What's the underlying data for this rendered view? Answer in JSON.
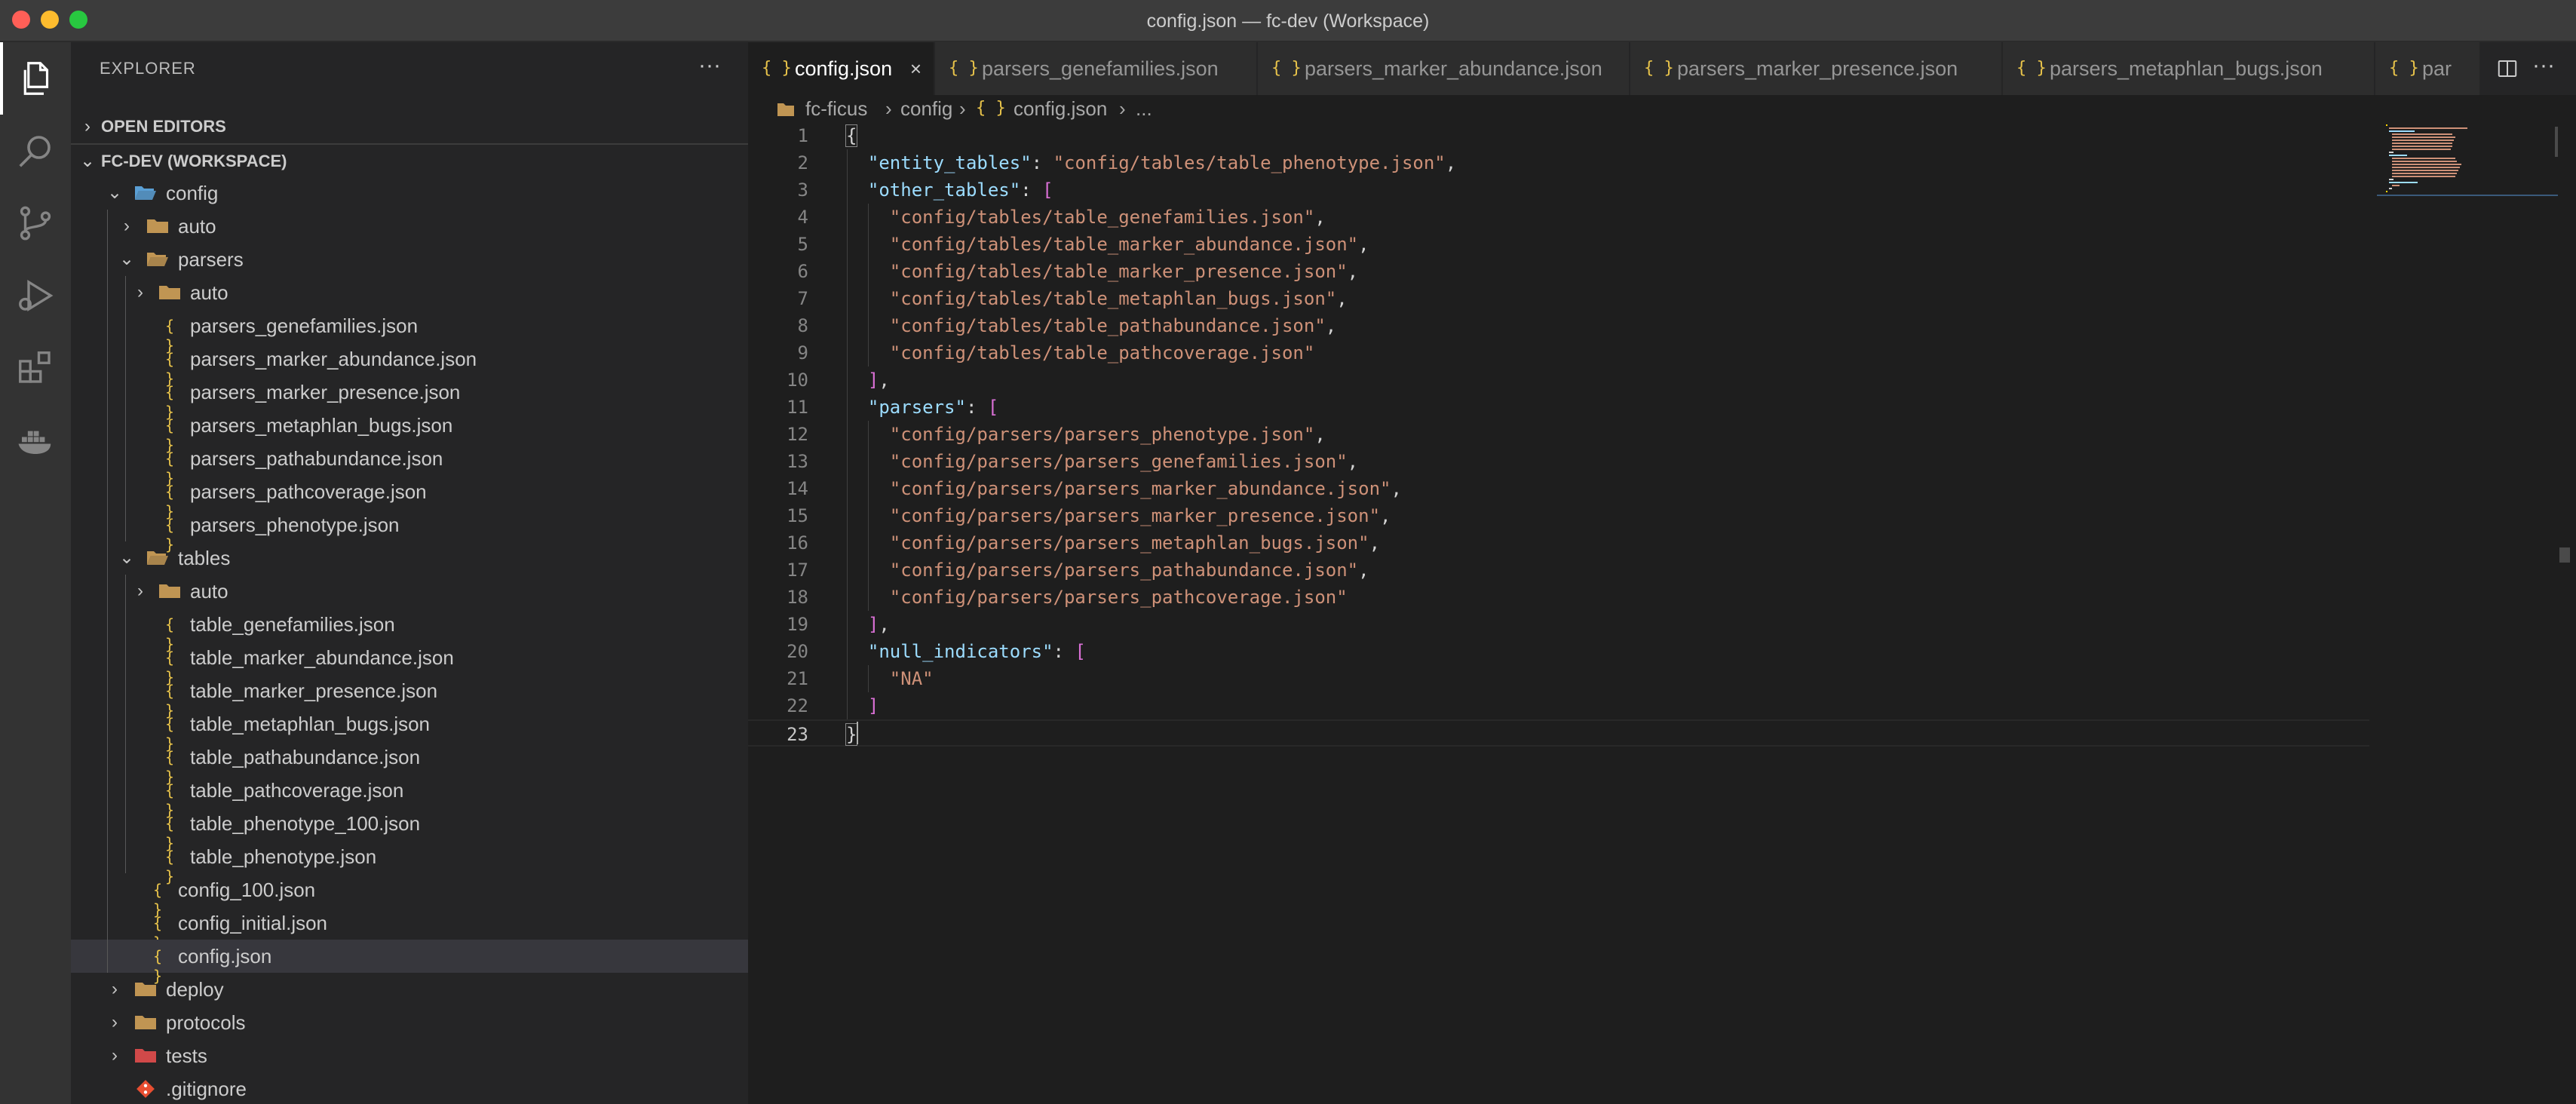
{
  "window": {
    "title": "config.json — fc-dev (Workspace)"
  },
  "activity_bar": [
    {
      "name": "explorer-icon",
      "active": true
    },
    {
      "name": "search-icon",
      "active": false
    },
    {
      "name": "source-control-icon",
      "active": false
    },
    {
      "name": "run-debug-icon",
      "active": false
    },
    {
      "name": "extensions-icon",
      "active": false
    },
    {
      "name": "docker-icon",
      "active": false
    }
  ],
  "sidebar": {
    "title": "EXPLORER",
    "more": "···",
    "open_editors": "OPEN EDITORS",
    "workspace": "FC-DEV (WORKSPACE)",
    "tree": [
      {
        "label": "config",
        "kind": "folder-open-special",
        "depth": 0,
        "expanded": true
      },
      {
        "label": "auto",
        "kind": "folder",
        "depth": 1,
        "expanded": false
      },
      {
        "label": "parsers",
        "kind": "folder-open",
        "depth": 1,
        "expanded": true
      },
      {
        "label": "auto",
        "kind": "folder",
        "depth": 2,
        "expanded": false
      },
      {
        "label": "parsers_genefamilies.json",
        "kind": "json",
        "depth": 2
      },
      {
        "label": "parsers_marker_abundance.json",
        "kind": "json",
        "depth": 2
      },
      {
        "label": "parsers_marker_presence.json",
        "kind": "json",
        "depth": 2
      },
      {
        "label": "parsers_metaphlan_bugs.json",
        "kind": "json",
        "depth": 2
      },
      {
        "label": "parsers_pathabundance.json",
        "kind": "json",
        "depth": 2
      },
      {
        "label": "parsers_pathcoverage.json",
        "kind": "json",
        "depth": 2
      },
      {
        "label": "parsers_phenotype.json",
        "kind": "json",
        "depth": 2
      },
      {
        "label": "tables",
        "kind": "folder-open",
        "depth": 1,
        "expanded": true
      },
      {
        "label": "auto",
        "kind": "folder",
        "depth": 2,
        "expanded": false
      },
      {
        "label": "table_genefamilies.json",
        "kind": "json",
        "depth": 2
      },
      {
        "label": "table_marker_abundance.json",
        "kind": "json",
        "depth": 2
      },
      {
        "label": "table_marker_presence.json",
        "kind": "json",
        "depth": 2
      },
      {
        "label": "table_metaphlan_bugs.json",
        "kind": "json",
        "depth": 2
      },
      {
        "label": "table_pathabundance.json",
        "kind": "json",
        "depth": 2
      },
      {
        "label": "table_pathcoverage.json",
        "kind": "json",
        "depth": 2
      },
      {
        "label": "table_phenotype_100.json",
        "kind": "json",
        "depth": 2
      },
      {
        "label": "table_phenotype.json",
        "kind": "json",
        "depth": 2
      },
      {
        "label": "config_100.json",
        "kind": "json",
        "depth": 1
      },
      {
        "label": "config_initial.json",
        "kind": "json",
        "depth": 1
      },
      {
        "label": "config.json",
        "kind": "json",
        "depth": 1,
        "selected": true
      },
      {
        "label": "deploy",
        "kind": "folder",
        "depth": 0,
        "expanded": false
      },
      {
        "label": "protocols",
        "kind": "folder",
        "depth": 0,
        "expanded": false
      },
      {
        "label": "tests",
        "kind": "folder-special",
        "depth": 0,
        "expanded": false
      },
      {
        "label": ".gitignore",
        "kind": "git",
        "depth": 0
      }
    ]
  },
  "tabs": [
    {
      "label": "config.json",
      "active": true,
      "close": "×"
    },
    {
      "label": "parsers_genefamilies.json",
      "active": false
    },
    {
      "label": "parsers_marker_abundance.json",
      "active": false
    },
    {
      "label": "parsers_marker_presence.json",
      "active": false
    },
    {
      "label": "parsers_metaphlan_bugs.json",
      "active": false
    },
    {
      "label": "par",
      "active": false
    }
  ],
  "tab_json_icon": "{ }",
  "tab_more": "···",
  "breadcrumb": {
    "root": "fc-ficus",
    "folder": "config",
    "file": "config.json",
    "tail": "..."
  },
  "code_lines": [
    "{",
    "  \"entity_tables\": \"config/tables/table_phenotype.json\",",
    "  \"other_tables\": [",
    "    \"config/tables/table_genefamilies.json\",",
    "    \"config/tables/table_marker_abundance.json\",",
    "    \"config/tables/table_marker_presence.json\",",
    "    \"config/tables/table_metaphlan_bugs.json\",",
    "    \"config/tables/table_pathabundance.json\",",
    "    \"config/tables/table_pathcoverage.json\"",
    "  ],",
    "  \"parsers\": [",
    "    \"config/parsers/parsers_phenotype.json\",",
    "    \"config/parsers/parsers_genefamilies.json\",",
    "    \"config/parsers/parsers_marker_abundance.json\",",
    "    \"config/parsers/parsers_marker_presence.json\",",
    "    \"config/parsers/parsers_metaphlan_bugs.json\",",
    "    \"config/parsers/parsers_pathabundance.json\",",
    "    \"config/parsers/parsers_pathcoverage.json\"",
    "  ],",
    "  \"null_indicators\": [",
    "    \"NA\"",
    "  ]",
    "}"
  ],
  "current_line": 23,
  "colors": {
    "key": "#9cdcfe",
    "string": "#ce9178",
    "bracket": "#ffd700",
    "json_icon": "#e8c34a",
    "selected_row": "#37373d"
  }
}
